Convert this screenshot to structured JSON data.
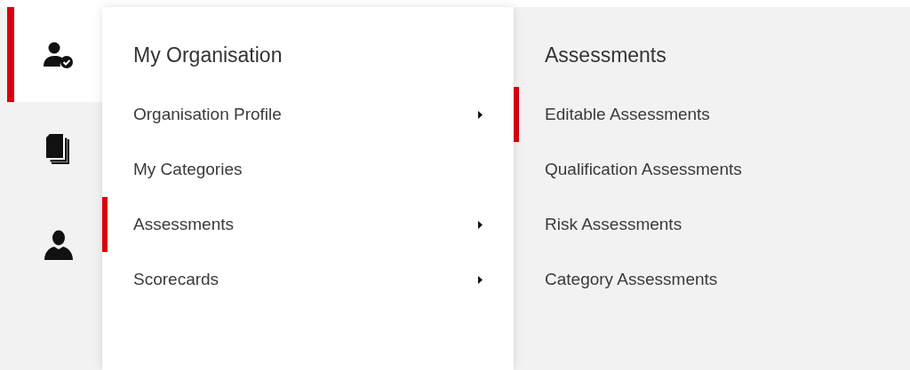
{
  "rail": [
    {
      "kind": "user-check",
      "selected": true
    },
    {
      "kind": "documents",
      "selected": false
    },
    {
      "kind": "user",
      "selected": false
    }
  ],
  "menu": {
    "title": "My Organisation",
    "items": [
      {
        "label": "Organisation Profile",
        "has_submenu": true,
        "selected": false
      },
      {
        "label": "My Categories",
        "has_submenu": false,
        "selected": false
      },
      {
        "label": "Assessments",
        "has_submenu": true,
        "selected": true
      },
      {
        "label": "Scorecards",
        "has_submenu": true,
        "selected": false
      }
    ]
  },
  "submenu": {
    "title": "Assessments",
    "items": [
      {
        "label": "Editable Assessments",
        "selected": true
      },
      {
        "label": "Qualification Assessments",
        "selected": false
      },
      {
        "label": "Risk Assessments",
        "selected": false
      },
      {
        "label": "Category Assessments",
        "selected": false
      }
    ]
  }
}
